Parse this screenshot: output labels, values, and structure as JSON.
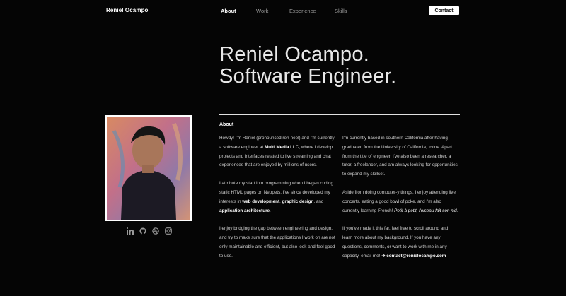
{
  "nav": {
    "brand": "Reniel Ocampo",
    "items": [
      {
        "label": "About"
      },
      {
        "label": "Work"
      },
      {
        "label": "Experience"
      },
      {
        "label": "Skills"
      }
    ],
    "contact_label": "Contact"
  },
  "hero": {
    "line1": "Reniel Ocampo.",
    "line2": "Software Engineer."
  },
  "about": {
    "title": "About",
    "p1_a": "Howdy! I'm Reniel (pronounced reh-neel) and I'm currently a software engineer at ",
    "p1_b": "Multi Media LLC",
    "p1_c": ", where I develop projects and interfaces related to live streaming and chat experiences that are enjoyed by millions of users.",
    "p2_a": "I attribute my start into programming when I began coding static HTML pages on Neopets. I've since developed my interests in ",
    "p2_b": "web development",
    "p2_c": ", ",
    "p2_d": "graphic design",
    "p2_e": ", and ",
    "p2_f": "application architecture",
    "p2_g": ".",
    "p3": "I enjoy bridging the gap between engineering and design, and try to make sure that the applications I work on are not only maintainable and efficient, but also look and feel good to use.",
    "p4": "I'm currently based in southern California after having graduated from the University of California, Irvine. Apart from the title of engineer, I've also been a researcher, a tutor, a freelancer, and am always looking for opportunities to expand my skillset.",
    "p5_a": "Aside from doing computer-y things, I enjoy attending live concerts, eating a good bowl of poke, and I'm also currently learning French! ",
    "p5_b": "Petit à petit, l'oiseau fait son nid.",
    "p6_a": "If you've made it this far, feel free to scroll around and learn more about my background. If you have any questions, comments, or want to work with me in any capacity, email me! ",
    "p6_b": "➔ contact@renielocampo.com"
  },
  "social": [
    {
      "icon": "linkedin-icon"
    },
    {
      "icon": "github-icon"
    },
    {
      "icon": "dribbble-icon"
    },
    {
      "icon": "instagram-icon"
    }
  ]
}
